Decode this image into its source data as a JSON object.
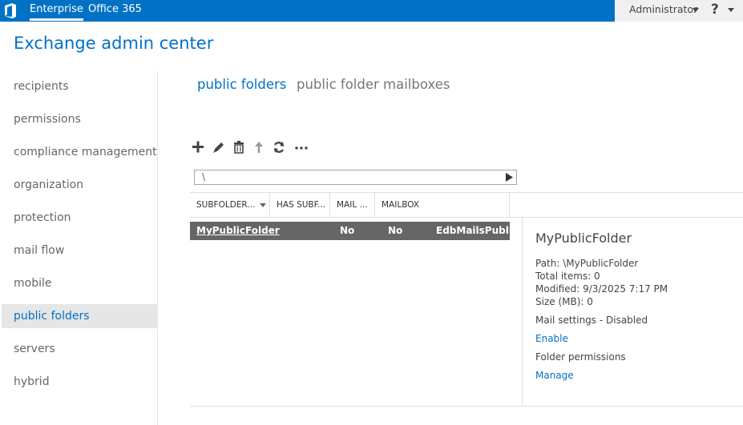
{
  "topbar": {
    "logo_icon": "office-logo-icon",
    "tabs": [
      {
        "label": "Enterprise",
        "active": true
      },
      {
        "label": "Office 365",
        "active": false
      }
    ],
    "user_label": "Administrator",
    "help_label": "?"
  },
  "app_title": "Exchange admin center",
  "nav": {
    "items": [
      {
        "label": "recipients"
      },
      {
        "label": "permissions"
      },
      {
        "label": "compliance management"
      },
      {
        "label": "organization"
      },
      {
        "label": "protection"
      },
      {
        "label": "mail flow"
      },
      {
        "label": "mobile"
      },
      {
        "label": "public folders"
      },
      {
        "label": "servers"
      },
      {
        "label": "hybrid"
      }
    ],
    "active_item": "public folders"
  },
  "main_tabs": [
    {
      "label": "public folders",
      "active": true
    },
    {
      "label": "public folder mailboxes",
      "active": false
    }
  ],
  "toolbar": {
    "buttons": [
      "add-icon",
      "edit-icon",
      "delete-icon",
      "move-up-icon",
      "refresh-icon",
      "more-icon"
    ]
  },
  "path": {
    "value": "\\"
  },
  "grid": {
    "columns": [
      "SUBFOLDER...",
      "HAS SUBF...",
      "MAIL ...",
      "MAILBOX"
    ],
    "rows": [
      {
        "name": "MyPublicFolder",
        "has_subfolders": "No",
        "mail_enabled": "No",
        "mailbox": "EdbMailsPubli..."
      }
    ]
  },
  "detail": {
    "title": "MyPublicFolder",
    "path": "Path: \\MyPublicFolder",
    "total_items": "Total items: 0",
    "modified": "Modified: 9/3/2025 7:17 PM",
    "size": "Size (MB): 0",
    "mail_settings": "Mail settings - Disabled",
    "enable_link": "Enable",
    "folder_permissions": "Folder permissions",
    "manage_link": "Manage"
  },
  "colors": {
    "accent": "#0072c6",
    "selected_row": "#666666",
    "nav_active_bg": "#e6e6e6"
  }
}
